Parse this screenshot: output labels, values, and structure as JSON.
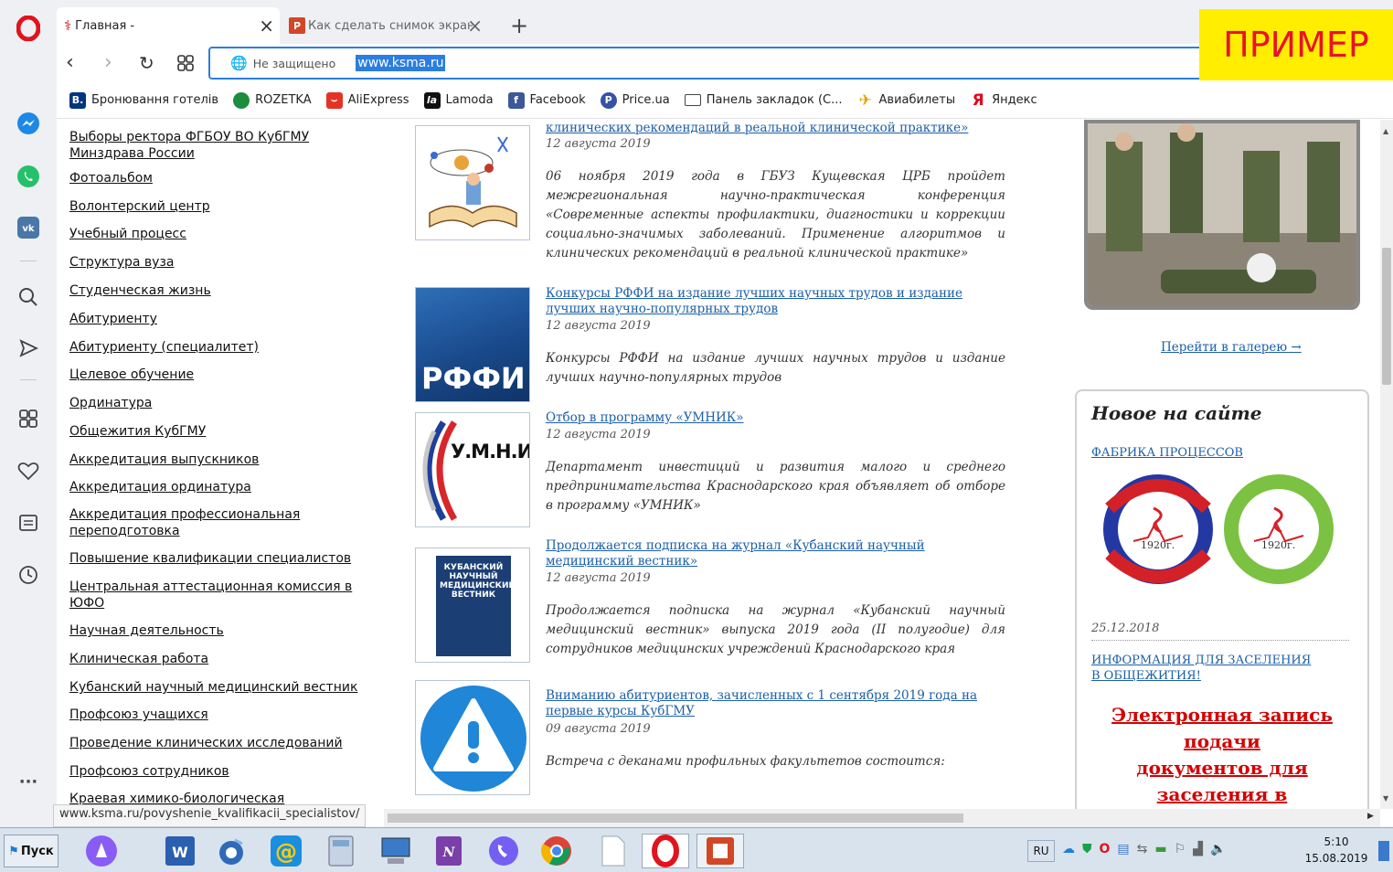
{
  "browser": {
    "tabs": [
      {
        "label": "Главная -"
      },
      {
        "label": "Как сделать снимок экрана"
      }
    ],
    "security_label": "Не защищено",
    "url": "www.ksma.ru",
    "watermark": "ПРИМЕР",
    "status_url": "www.ksma.ru/povyshenie_kvalifikacii_specialistov/"
  },
  "bookmarks": [
    {
      "label": "Бронювання готелів",
      "icon": "booking-icon"
    },
    {
      "label": "ROZETKA",
      "icon": "rozetka-icon"
    },
    {
      "label": "AliExpress",
      "icon": "aliexpress-icon"
    },
    {
      "label": "Lamoda",
      "icon": "lamoda-icon"
    },
    {
      "label": "Facebook",
      "icon": "facebook-icon"
    },
    {
      "label": "Price.ua",
      "icon": "priceua-icon"
    },
    {
      "label": "Панель закладок (С...",
      "icon": "folder-icon"
    },
    {
      "label": "Авиабилеты",
      "icon": "plane-icon"
    },
    {
      "label": "Яндекс",
      "icon": "yandex-icon"
    }
  ],
  "left_nav": [
    "Выборы ректора ФГБОУ ВО КубГМУ Минздрава России",
    "Фотоальбом",
    "Волонтерский центр",
    "Учебный процесс",
    "Структура вуза",
    "Студенческая жизнь",
    "Абитуриенту",
    "Абитуриенту (специалитет)",
    "Целевое обучение",
    "Ординатура",
    "Общежития КубГМУ",
    "Аккредитация выпускников",
    "Аккредитация ординатура",
    "Аккредитация профессиональная переподготовка",
    "Повышение квалификации специалистов",
    "Центральная аттестационная комиссия в ЮФО",
    "Научная деятельность",
    "Клиническая работа",
    "Кубанский научный медицинский вестник",
    "Профсоюз учащихся",
    "Проведение клинических исследований",
    "Профсоюз сотрудников",
    "Краевая химико-биологическая"
  ],
  "news": [
    {
      "title": "клинических рекомендаций в реальной клинической практике»",
      "date": "12 августа 2019",
      "text": "06 ноября 2019 года в ГБУЗ Кущевская ЦРБ пройдет межрегиональная научно-практическая конференция «Современные аспекты профилактики, диагностики и коррекции социально-значимых заболеваний. Применение алгоритмов и клинических рекомендаций в реальной клинической практике»"
    },
    {
      "title": "Конкурсы РФФИ на издание лучших научных трудов и издание лучших научно-популярных трудов",
      "date": "12 августа 2019",
      "text": "Конкурсы РФФИ на издание лучших научных трудов и издание лучших научно-популярных трудов",
      "logo_text": "РФФИ"
    },
    {
      "title": "Отбор в программу «УМНИК»",
      "date": "12 августа 2019",
      "text": "Департамент инвестиций и развития малого и среднего предпринимательства Краснодарского края объявляет об отборе в программу «УМНИК»",
      "logo_text": "У.М.Н.И.К."
    },
    {
      "title": "Продолжается подписка на журнал «Кубанский научный медицинский вестник»",
      "date": "12 августа 2019",
      "text": "Продолжается подписка на журнал «Кубанский научный медицинский вестник» выпуска 2019 года (II полугодие) для сотрудников медицинских учреждений Краснодарского края",
      "logo_text": "КУБАНСКИЙ НАУЧНЫЙ МЕДИЦИНСКИЙ ВЕСТНИК"
    },
    {
      "title": "Вниманию абитуриентов, зачисленных с 1 сентября 2019 года на первые курсы КубГМУ",
      "date": "09 августа 2019",
      "text": "Встреча с деканами профильных факультетов состоится:"
    }
  ],
  "right": {
    "gallery_link": "Перейти в галерею →",
    "new_title": "Новое на сайте",
    "factory_link": "ФАБРИКА ПРОЦЕССОВ",
    "badge_year": "1920г.",
    "date": "25.12.2018",
    "dorm_link": "ИНФОРМАЦИЯ ДЛЯ ЗАСЕЛЕНИЯ В ОБЩЕЖИТИЯ!",
    "promo_lines": [
      "Электронная запись",
      "подачи",
      "документов для",
      "заселения в"
    ]
  },
  "taskbar": {
    "start": "Пуск",
    "lang": "RU",
    "time": "5:10",
    "date": "15.08.2019"
  },
  "colors": {
    "link": "#1c5fa8",
    "promo": "#d40000",
    "opera_red": "#e0141e",
    "watermark_bg": "#ffee00"
  }
}
